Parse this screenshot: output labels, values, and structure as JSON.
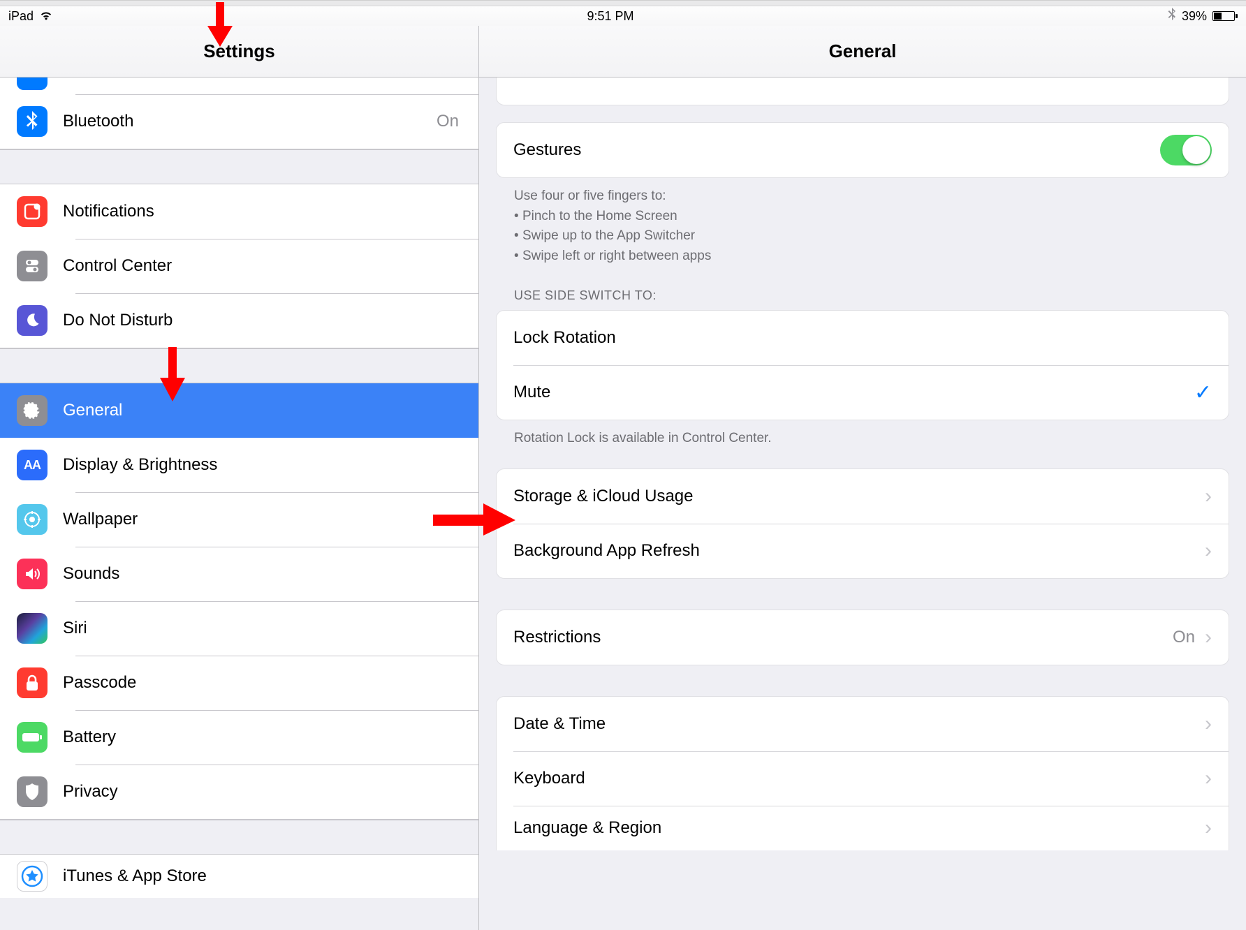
{
  "statusbar": {
    "device": "iPad",
    "time": "9:51 PM",
    "battery_percent": "39%"
  },
  "sidebar": {
    "title": "Settings",
    "items": [
      {
        "id": "bluetooth",
        "label": "Bluetooth",
        "detail": "On"
      },
      {
        "id": "notifications",
        "label": "Notifications"
      },
      {
        "id": "control-center",
        "label": "Control Center"
      },
      {
        "id": "dnd",
        "label": "Do Not Disturb"
      },
      {
        "id": "general",
        "label": "General"
      },
      {
        "id": "display",
        "label": "Display & Brightness"
      },
      {
        "id": "wallpaper",
        "label": "Wallpaper"
      },
      {
        "id": "sounds",
        "label": "Sounds"
      },
      {
        "id": "siri",
        "label": "Siri"
      },
      {
        "id": "passcode",
        "label": "Passcode"
      },
      {
        "id": "battery",
        "label": "Battery"
      },
      {
        "id": "privacy",
        "label": "Privacy"
      },
      {
        "id": "itunes",
        "label": "iTunes & App Store"
      }
    ]
  },
  "detail": {
    "title": "General",
    "gestures": {
      "label": "Gestures",
      "footer_intro": "Use four or five fingers to:",
      "footer_bullets": [
        "Pinch to the Home Screen",
        "Swipe up to the App Switcher",
        "Swipe left or right between apps"
      ]
    },
    "side_switch": {
      "header": "USE SIDE SWITCH TO:",
      "lock_rotation": "Lock Rotation",
      "mute": "Mute",
      "footer": "Rotation Lock is available in Control Center."
    },
    "storage": "Storage & iCloud Usage",
    "refresh": "Background App Refresh",
    "restrictions": {
      "label": "Restrictions",
      "value": "On"
    },
    "datetime": "Date & Time",
    "keyboard": "Keyboard",
    "language": "Language & Region"
  }
}
